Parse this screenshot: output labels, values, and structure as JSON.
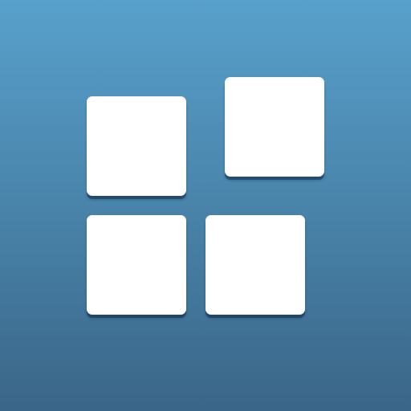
{
  "icon": {
    "name": "grid-tiles-icon",
    "colors": {
      "background_top": "#58a1cc",
      "background_bottom": "#3a6688",
      "tile": "#ffffff",
      "tile_shadow": "#2f5472"
    },
    "tiles": [
      {
        "name": "tile-top-left"
      },
      {
        "name": "tile-top-right"
      },
      {
        "name": "tile-bottom-left"
      },
      {
        "name": "tile-bottom-right"
      }
    ]
  }
}
